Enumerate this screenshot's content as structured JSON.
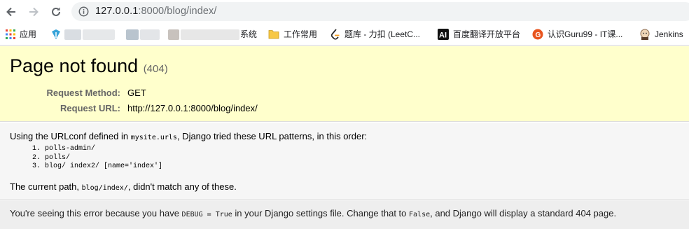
{
  "browser": {
    "url_host": "127.0.0.1",
    "url_path": ":8000/blog/index/",
    "bookmarks": [
      {
        "label": "应用",
        "icon": "apps-grid-icon"
      },
      {
        "label": "系统",
        "icon": "blurred-bookmark"
      },
      {
        "label": "工作常用",
        "icon": "folder-icon"
      },
      {
        "label": "题库 - 力扣 (LeetC...",
        "icon": "leetcode-icon"
      },
      {
        "label": "百度翻译开放平台",
        "icon": "ai-icon"
      },
      {
        "label": "认识Guru99 - IT课...",
        "icon": "guru99-icon"
      },
      {
        "label": "Jenkins",
        "icon": "jenkins-icon"
      }
    ]
  },
  "summary": {
    "title": "Page not found",
    "status_code": "(404)",
    "request_method_label": "Request Method:",
    "request_method_value": "GET",
    "request_url_label": "Request URL:",
    "request_url_value": "http://127.0.0.1:8000/blog/index/"
  },
  "info": {
    "intro_before": "Using the URLconf defined in ",
    "urlconf": "mysite.urls",
    "intro_after": ", Django tried these URL patterns, in this order:",
    "patterns": [
      "1.  polls-admin/",
      "2.  polls/",
      "3.  blog/ index2/ [name='index']"
    ],
    "current_before": "The current path, ",
    "current_path": "blog/index/",
    "current_after": ", didn't match any of these."
  },
  "explanation": {
    "before": "You're seeing this error because you have ",
    "debug_code": "DEBUG = True",
    "middle": " in your Django settings file. Change that to ",
    "false_code": "False",
    "after": ", and Django will display a standard 404 page."
  }
}
